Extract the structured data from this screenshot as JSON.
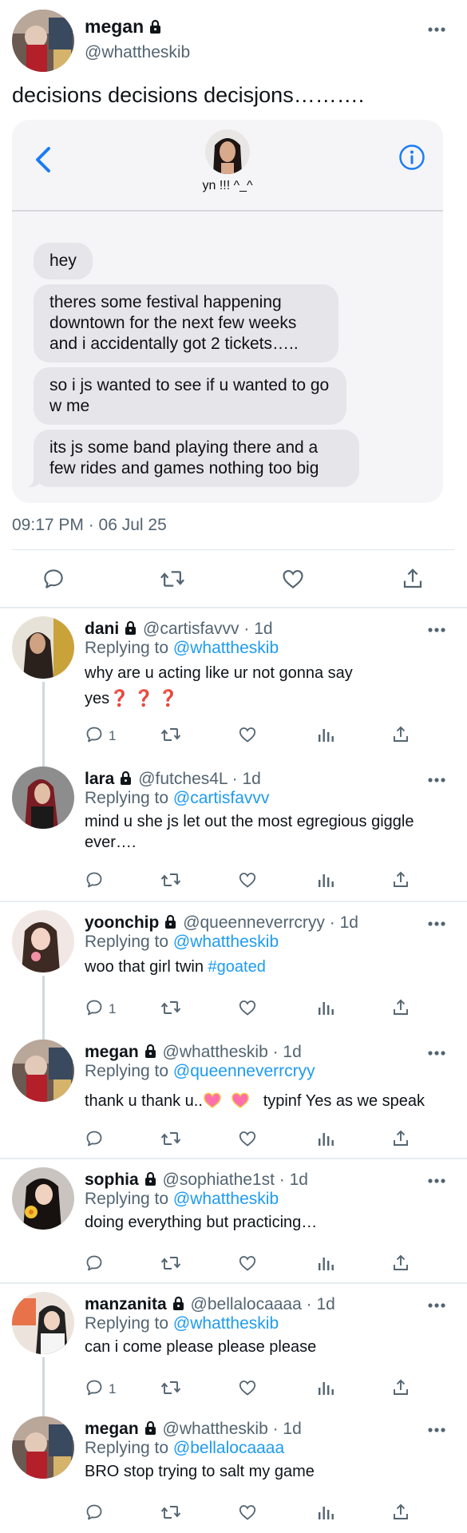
{
  "main_tweet": {
    "name": "megan",
    "handle": "@whattheskib",
    "text": "decisions decisions decisjons……….",
    "timestamp": "09:17 PM · 06 Jul 25"
  },
  "dm": {
    "contact_name": "yn !!! ^_^",
    "messages": [
      "hey",
      "theres some festival happening downtown for the next few weeks and i accidentally got 2 tickets…..",
      "so i js wanted to see if u wanted to go w me",
      "its js some band playing there and a few rides and games nothing too big"
    ]
  },
  "replies": [
    {
      "name": "dani",
      "handle": "@cartisfavvv",
      "time": "· 1d",
      "replying_prefix": "Replying to",
      "replying_to": "@whattheskib",
      "text_1": "why are u acting like ur not gonna say",
      "text_2": "yes",
      "marks": "❓ ❓ ❓",
      "reply_count": "1"
    },
    {
      "name": "lara",
      "handle": "@futches4L",
      "time": "· 1d",
      "replying_prefix": "Replying to",
      "replying_to": "@cartisfavvv",
      "text": "mind u she js let out the most egregious giggle ever…."
    },
    {
      "name": "yoonchip",
      "handle": "@queenneverrcryy",
      "time": "· 1d",
      "replying_prefix": "Replying to",
      "replying_to": "@whattheskib",
      "text": "woo that girl twin",
      "hashtag": "#goated",
      "reply_count": "1"
    },
    {
      "name": "megan",
      "handle": "@whattheskib",
      "time": "· 1d",
      "replying_prefix": "Replying to",
      "replying_to": "@queenneverrcryy",
      "text_1": "thank u thank u..",
      "text_2": "typinf Yes as we speak"
    },
    {
      "name": "sophia",
      "handle": "@sophiathe1st",
      "time": "· 1d",
      "replying_prefix": "Replying to",
      "replying_to": "@whattheskib",
      "text": "doing everything but practicing…"
    },
    {
      "name": "manzanita",
      "handle": "@bellalocaaaa",
      "time": "· 1d",
      "replying_prefix": "Replying to",
      "replying_to": "@whattheskib",
      "text": "can i come please please please",
      "reply_count": "1"
    },
    {
      "name": "megan",
      "handle": "@whattheskib",
      "time": "· 1d",
      "replying_prefix": "Replying to",
      "replying_to": "@bellalocaaaa",
      "text": "BRO stop trying to salt my game"
    }
  ],
  "colors": {
    "accent": "#1d9bf0",
    "secondary_text": "#536471",
    "bubble": "#e5e5ea",
    "dm_background": "#f5f5f7",
    "question_mark": "#e0245e"
  },
  "icons": [
    "lock-icon",
    "more-icon",
    "back-chevron-icon",
    "info-icon",
    "reply-icon",
    "retweet-icon",
    "like-icon",
    "views-icon",
    "share-icon",
    "heart-emoji-icon"
  ]
}
